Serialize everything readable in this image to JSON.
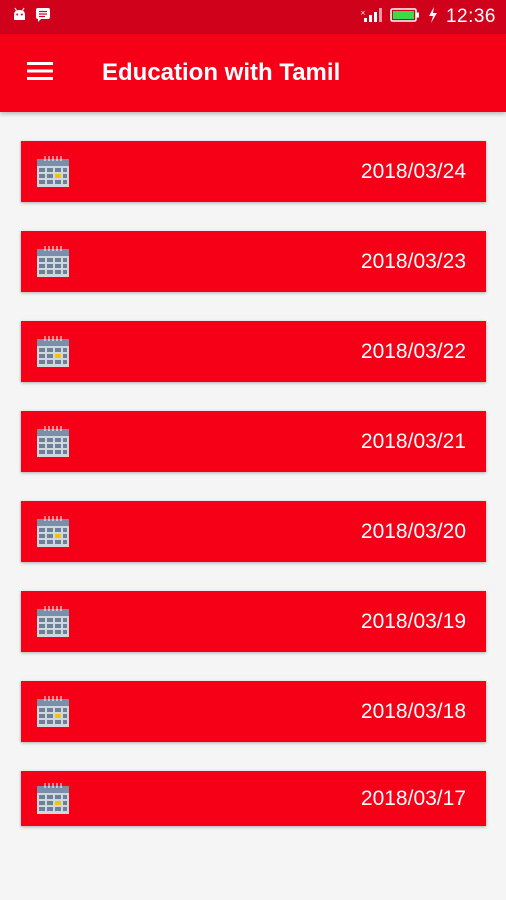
{
  "status_bar": {
    "time": "12:36",
    "icons": [
      "android-icon",
      "message-icon",
      "signal-icon",
      "battery-icon",
      "charging-icon"
    ]
  },
  "app_bar": {
    "title": "Education with Tamil",
    "menu_icon": "hamburger-menu-icon"
  },
  "colors": {
    "primary": "#f50016",
    "status_bar": "#d0011b",
    "background": "#f5f5f5"
  },
  "list": {
    "item_icon": "calendar-icon",
    "items": [
      {
        "date": "2018/03/24"
      },
      {
        "date": "2018/03/23"
      },
      {
        "date": "2018/03/22"
      },
      {
        "date": "2018/03/21"
      },
      {
        "date": "2018/03/20"
      },
      {
        "date": "2018/03/19"
      },
      {
        "date": "2018/03/18"
      },
      {
        "date": "2018/03/17"
      }
    ]
  }
}
